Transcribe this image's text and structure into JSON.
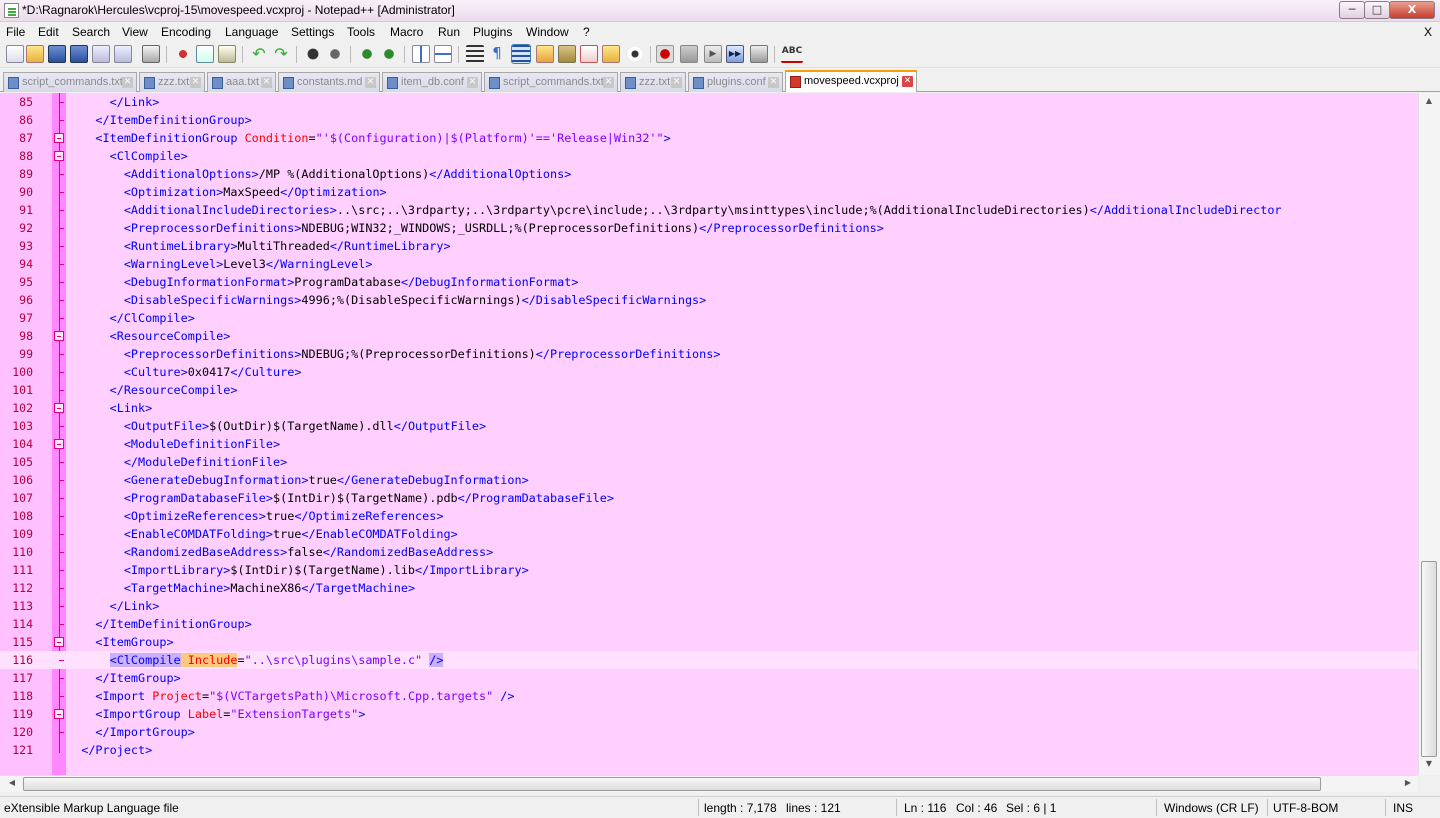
{
  "window": {
    "title": "*D:\\Ragnarok\\Hercules\\vcproj-15\\movespeed.vcxproj - Notepad++ [Administrator]",
    "minimize_glyph": "─",
    "maximize_glyph": "□",
    "close_glyph": "X"
  },
  "menu": {
    "items": [
      "File",
      "Edit",
      "Search",
      "View",
      "Encoding",
      "Language",
      "Settings",
      "Tools",
      "Macro",
      "Run",
      "Plugins",
      "Window",
      "?"
    ],
    "close_label": "X"
  },
  "toolbar": {
    "icons": [
      "new-file-icon",
      "open-file-icon",
      "save-icon",
      "save-all-icon",
      "close-icon",
      "close-all-icon",
      "print-icon",
      "cut-icon",
      "copy-icon",
      "paste-icon",
      "undo-icon",
      "redo-icon",
      "find-icon",
      "replace-icon",
      "zoom-in-icon",
      "zoom-out-icon",
      "sync-vertical-icon",
      "sync-horizontal-icon",
      "word-wrap-icon",
      "show-all-chars-icon",
      "indent-guide-icon",
      "user-language-icon",
      "document-map-icon",
      "function-list-icon",
      "folder-workspace-icon",
      "monitoring-icon",
      "record-macro-icon",
      "stop-record-icon",
      "playback-macro-icon",
      "run-macro-multiple-icon",
      "save-macro-icon",
      "spell-check-icon"
    ],
    "colors": {
      "record": "#cc0000",
      "accent": "#3c7fb1"
    }
  },
  "tabs": [
    {
      "label": "script_commands.txt",
      "active": false
    },
    {
      "label": "zzz.txt",
      "active": false
    },
    {
      "label": "aaa.txt",
      "active": false
    },
    {
      "label": "constants.md",
      "active": false
    },
    {
      "label": "item_db.conf",
      "active": false
    },
    {
      "label": "script_commands.txt",
      "active": false
    },
    {
      "label": "zzz.txt",
      "active": false
    },
    {
      "label": "plugins.conf",
      "active": false
    },
    {
      "label": "movespeed.vcxproj",
      "active": true
    }
  ],
  "editor": {
    "colors": {
      "background": "#ffd0ff",
      "gutter": "#ffc0ff",
      "fold_margin": "#ff88ff",
      "tag": "#0000ff",
      "attribute": "#ff0000",
      "value": "#8000ff"
    },
    "lines": [
      {
        "num": "85",
        "text": "      </Link>"
      },
      {
        "num": "86",
        "text": "    </ItemDefinitionGroup>"
      },
      {
        "num": "87",
        "text": "    <ItemDefinitionGroup Condition=\"'$(Configuration)|$(Platform)'=='Release|Win32'\">"
      },
      {
        "num": "88",
        "text": "      <ClCompile>"
      },
      {
        "num": "89",
        "text": "        <AdditionalOptions>/MP %(AdditionalOptions)</AdditionalOptions>"
      },
      {
        "num": "90",
        "text": "        <Optimization>MaxSpeed</Optimization>"
      },
      {
        "num": "91",
        "text": "        <AdditionalIncludeDirectories>..\\src;..\\3rdparty;..\\3rdparty\\pcre\\include;..\\3rdparty\\msinttypes\\include;%(AdditionalIncludeDirectories)</AdditionalIncludeDirector"
      },
      {
        "num": "92",
        "text": "        <PreprocessorDefinitions>NDEBUG;WIN32;_WINDOWS;_USRDLL;%(PreprocessorDefinitions)</PreprocessorDefinitions>"
      },
      {
        "num": "93",
        "text": "        <RuntimeLibrary>MultiThreaded</RuntimeLibrary>"
      },
      {
        "num": "94",
        "text": "        <WarningLevel>Level3</WarningLevel>"
      },
      {
        "num": "95",
        "text": "        <DebugInformationFormat>ProgramDatabase</DebugInformationFormat>"
      },
      {
        "num": "96",
        "text": "        <DisableSpecificWarnings>4996;%(DisableSpecificWarnings)</DisableSpecificWarnings>"
      },
      {
        "num": "97",
        "text": "      </ClCompile>"
      },
      {
        "num": "98",
        "text": "      <ResourceCompile>"
      },
      {
        "num": "99",
        "text": "        <PreprocessorDefinitions>NDEBUG;%(PreprocessorDefinitions)</PreprocessorDefinitions>"
      },
      {
        "num": "100",
        "text": "        <Culture>0x0417</Culture>"
      },
      {
        "num": "101",
        "text": "      </ResourceCompile>"
      },
      {
        "num": "102",
        "text": "      <Link>"
      },
      {
        "num": "103",
        "text": "        <OutputFile>$(OutDir)$(TargetName).dll</OutputFile>"
      },
      {
        "num": "104",
        "text": "        <ModuleDefinitionFile>"
      },
      {
        "num": "105",
        "text": "        </ModuleDefinitionFile>"
      },
      {
        "num": "106",
        "text": "        <GenerateDebugInformation>true</GenerateDebugInformation>"
      },
      {
        "num": "107",
        "text": "        <ProgramDatabaseFile>$(IntDir)$(TargetName).pdb</ProgramDatabaseFile>"
      },
      {
        "num": "108",
        "text": "        <OptimizeReferences>true</OptimizeReferences>"
      },
      {
        "num": "109",
        "text": "        <EnableCOMDATFolding>true</EnableCOMDATFolding>"
      },
      {
        "num": "110",
        "text": "        <RandomizedBaseAddress>false</RandomizedBaseAddress>"
      },
      {
        "num": "111",
        "text": "        <ImportLibrary>$(IntDir)$(TargetName).lib</ImportLibrary>"
      },
      {
        "num": "112",
        "text": "        <TargetMachine>MachineX86</TargetMachine>"
      },
      {
        "num": "113",
        "text": "      </Link>"
      },
      {
        "num": "114",
        "text": "    </ItemDefinitionGroup>"
      },
      {
        "num": "115",
        "text": "    <ItemGroup>"
      },
      {
        "num": "116",
        "text": "      <ClCompile Include=\"..\\src\\plugins\\sample.c\" />"
      },
      {
        "num": "117",
        "text": "    </ItemGroup>"
      },
      {
        "num": "118",
        "text": "    <Import Project=\"$(VCTargetsPath)\\Microsoft.Cpp.targets\" />"
      },
      {
        "num": "119",
        "text": "    <ImportGroup Label=\"ExtensionTargets\">"
      },
      {
        "num": "120",
        "text": "    </ImportGroup>"
      },
      {
        "num": "121",
        "text": "  </Project>"
      }
    ]
  },
  "status": {
    "file_type": "eXtensible Markup Language file",
    "length": "length : 7,178",
    "lines": "lines : 121",
    "ln": "Ln : 116",
    "col": "Col : 46",
    "sel": "Sel : 6 | 1",
    "eol": "Windows (CR LF)",
    "encoding": "UTF-8-BOM",
    "mode": "INS"
  }
}
